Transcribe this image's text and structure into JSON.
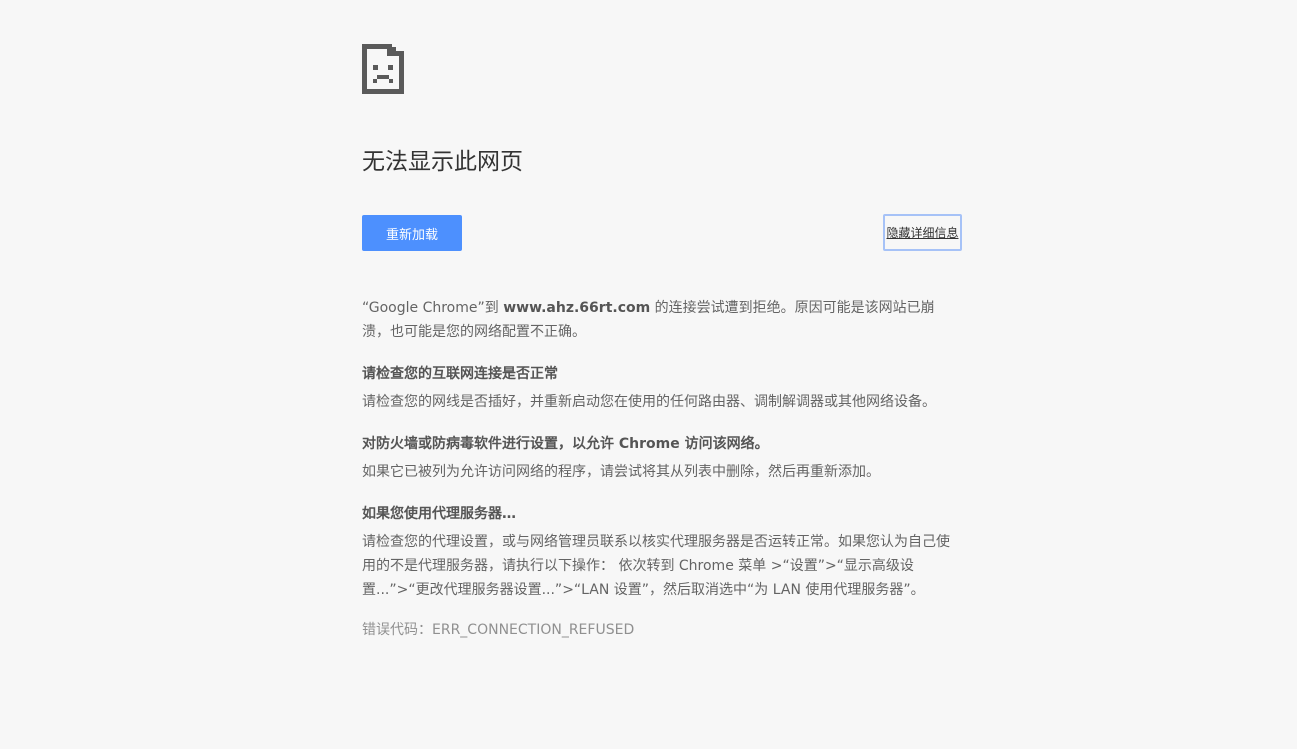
{
  "page": {
    "title": "无法显示此网页",
    "icon": "sad-page-icon"
  },
  "buttons": {
    "reload": "重新加载",
    "details": "隐藏详细信息"
  },
  "summary": {
    "prefix": "“Google Chrome”到 ",
    "host": "www.ahz.66rt.com",
    "suffix": " 的连接尝试遭到拒绝。原因可能是该网站已崩溃，也可能是您的网络配置不正确。"
  },
  "sections": [
    {
      "heading": "请检查您的互联网连接是否正常",
      "body": "请检查您的网线是否插好，并重新启动您在使用的任何路由器、调制解调器或其他网络设备。"
    },
    {
      "heading": "对防火墙或防病毒软件进行设置，以允许 Chrome 访问该网络。",
      "body": "如果它已被列为允许访问网络的程序，请尝试将其从列表中删除，然后再重新添加。"
    },
    {
      "heading": "如果您使用代理服务器…",
      "body": "请检查您的代理设置，或与网络管理员联系以核实代理服务器是否运转正常。如果您认为自己使用的不是代理服务器，请执行以下操作： 依次转到 Chrome 菜单 >“设置”>“显示高级设置...”>“更改代理服务器设置...”>“LAN 设置”，然后取消选中“为 LAN 使用代理服务器”。"
    }
  ],
  "error_code": "错误代码：ERR_CONNECTION_REFUSED",
  "colors": {
    "background": "#f7f7f7",
    "button_blue": "#4d90fe",
    "details_border": "#a6c2f7",
    "icon_gray": "#5a5a5a"
  }
}
